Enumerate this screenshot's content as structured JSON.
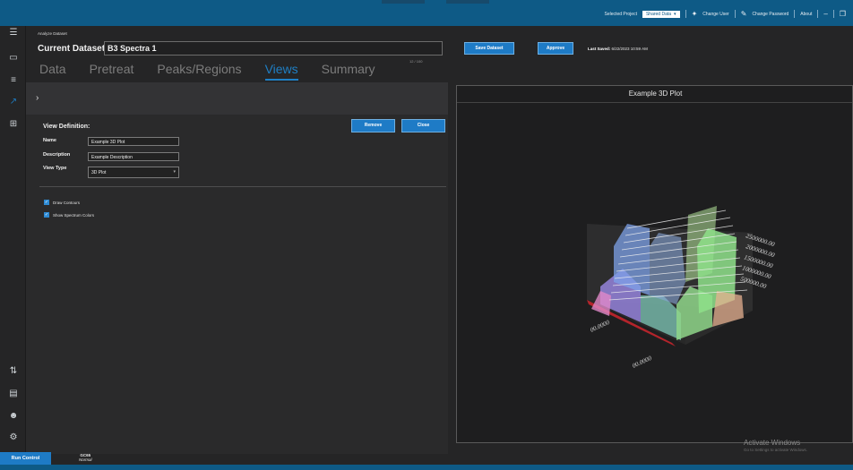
{
  "topbar": {
    "selected_project_label": "Selected Project",
    "selected_project_value": "Shared Data",
    "change_user": "Change User",
    "change_password": "Change Password",
    "about": "About"
  },
  "breadcrumb": "Analyze Dataset",
  "dataset": {
    "label": "Current Dataset:",
    "name": "B3 Spectra 1",
    "char_count": "12 / 100"
  },
  "tabs": [
    {
      "label": "Data",
      "active": false
    },
    {
      "label": "Pretreat",
      "active": false
    },
    {
      "label": "Peaks/Regions",
      "active": false
    },
    {
      "label": "Views",
      "active": true
    },
    {
      "label": "Summary",
      "active": false
    }
  ],
  "actions": {
    "save_dataset": "Save Dataset",
    "approve": "Approve",
    "last_saved_label": "Last Saved:",
    "last_saved_value": "6/22/2023 10:59 AM"
  },
  "view_definition": {
    "title": "View Definition:",
    "remove": "Remove",
    "close": "Close",
    "name_label": "Name",
    "name_value": "Example 3D Plot",
    "description_label": "Description",
    "description_value": "Example Description",
    "view_type_label": "View Type",
    "view_type_value": "3D Plot",
    "draw_contours": "Draw Contours",
    "show_spectrum_colors": "Show Spectrum Colors"
  },
  "plot": {
    "title": "Example 3D Plot",
    "z_ticks": [
      "2500000.00",
      "2000000.00",
      "1500000.00",
      "1000000.00",
      "500000.00"
    ],
    "x_tick": "00.0000",
    "y_tick": "00.0000"
  },
  "watermark": {
    "line1": "Activate Windows",
    "line2": "Go to Settings to activate Windows."
  },
  "status": {
    "run_control": "Run Control",
    "instrument": "GC65",
    "mode": "Normal"
  },
  "colors": {
    "accent": "#1e7bc6",
    "topbar": "#0e5a86",
    "active_tab": "#1f7fc4"
  },
  "nav_icons": [
    "menu-icon",
    "monitor-icon",
    "database-icon",
    "chart-icon",
    "table-icon",
    "git-compare-icon",
    "document-icon",
    "users-icon",
    "gear-icon"
  ]
}
